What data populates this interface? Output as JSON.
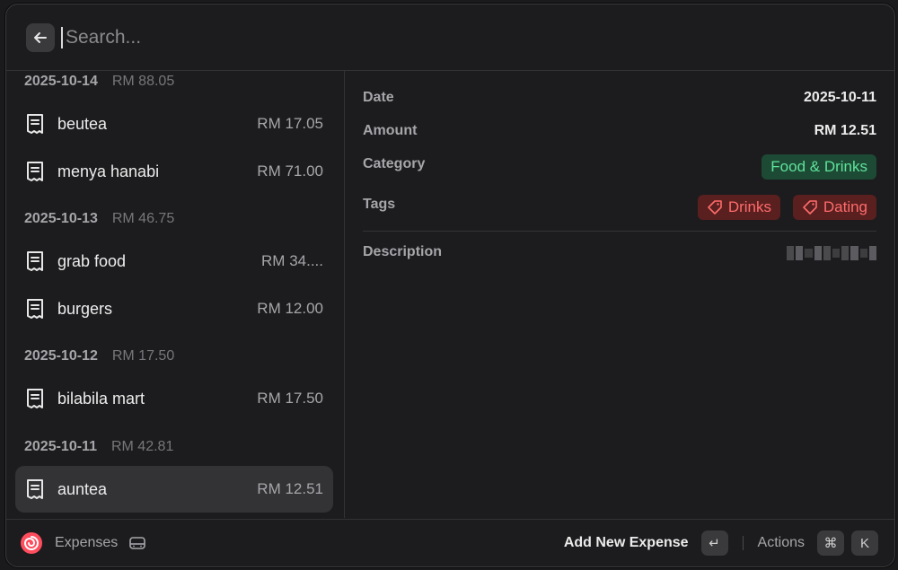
{
  "search": {
    "placeholder": "Search..."
  },
  "list": {
    "groups": [
      {
        "date": "2025-10-14",
        "total": "RM 88.05",
        "items": [
          {
            "title": "beutea",
            "amount": "RM 17.05"
          },
          {
            "title": "menya hanabi",
            "amount": "RM 71.00"
          }
        ]
      },
      {
        "date": "2025-10-13",
        "total": "RM 46.75",
        "items": [
          {
            "title": "grab food",
            "amount": "RM 34...."
          },
          {
            "title": "burgers",
            "amount": "RM 12.00"
          }
        ]
      },
      {
        "date": "2025-10-12",
        "total": "RM 17.50",
        "items": [
          {
            "title": "bilabila mart",
            "amount": "RM 17.50"
          }
        ]
      },
      {
        "date": "2025-10-11",
        "total": "RM 42.81",
        "items": [
          {
            "title": "auntea",
            "amount": "RM 12.51",
            "selected": true
          }
        ]
      }
    ]
  },
  "detail": {
    "date_label": "Date",
    "date_value": "2025-10-11",
    "amount_label": "Amount",
    "amount_value": "RM 12.51",
    "category_label": "Category",
    "category_value": "Food & Drinks",
    "tags_label": "Tags",
    "tags": [
      "Drinks",
      "Dating"
    ],
    "description_label": "Description"
  },
  "footer": {
    "title": "Expenses",
    "primary_action": "Add New Expense",
    "enter_key": "↵",
    "actions_label": "Actions",
    "shortcut_keys": [
      "⌘",
      "K"
    ]
  },
  "colors": {
    "category_bg": "#1d4a35",
    "category_fg": "#5ee39a",
    "tag_bg": "#5a1f1f",
    "tag_fg": "#ff6b6b",
    "selected_row": "#333336"
  }
}
